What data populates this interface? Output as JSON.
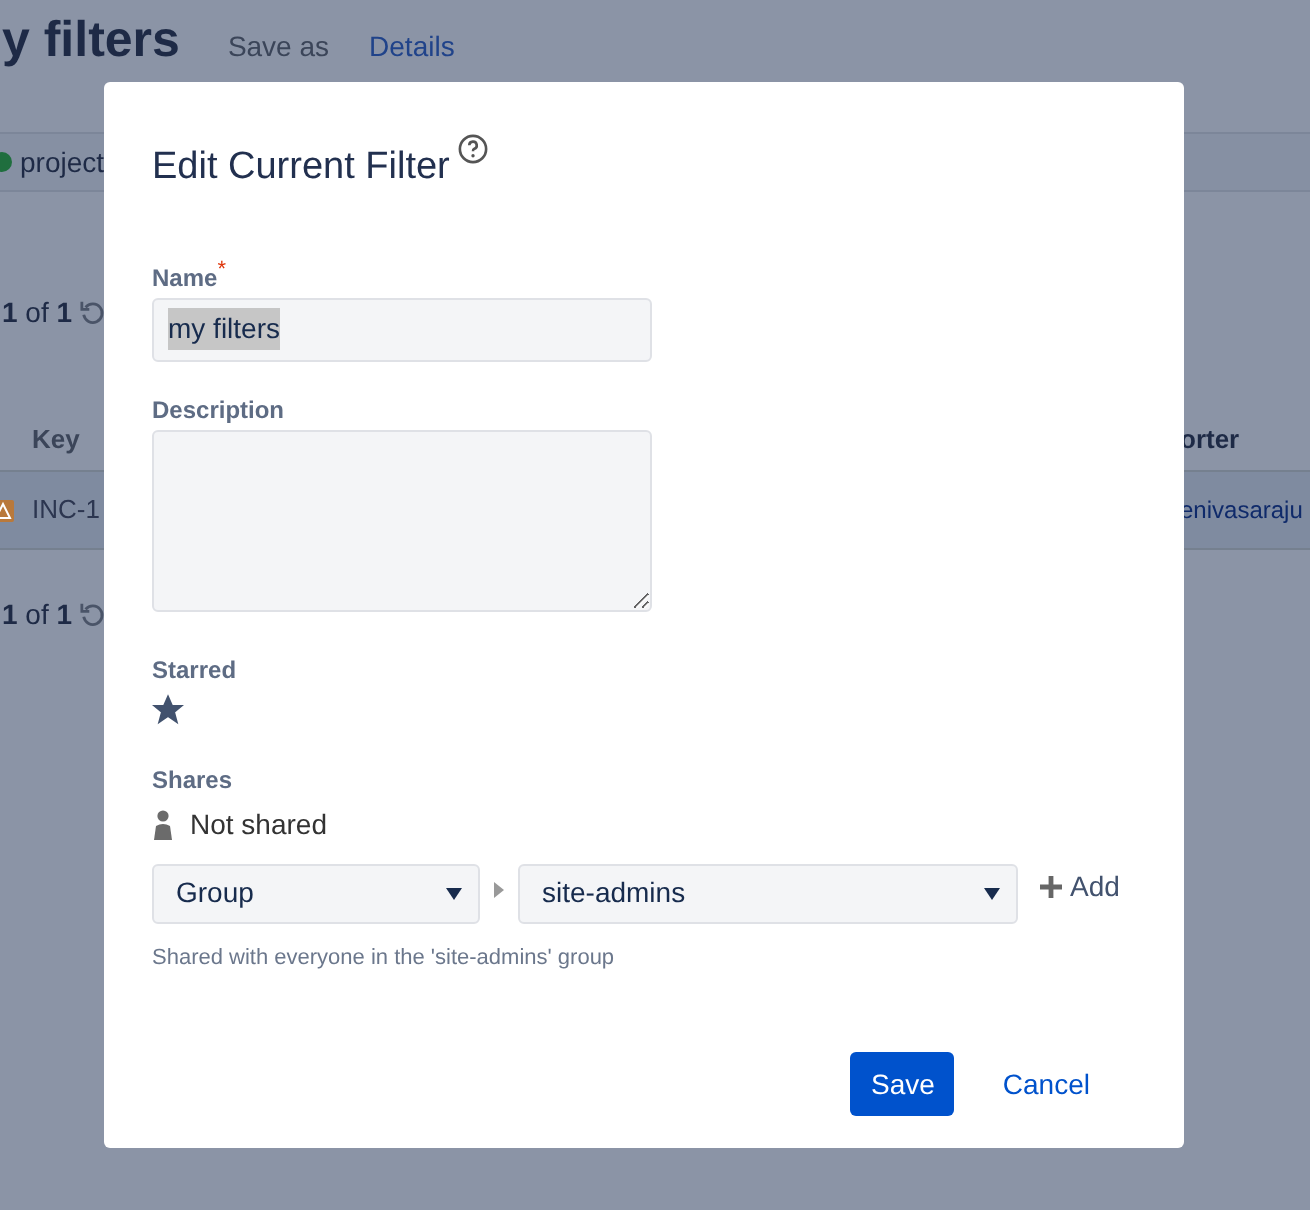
{
  "page": {
    "title": "y filters",
    "links": [
      {
        "label": "Save as",
        "kind": "plain"
      },
      {
        "label": "Details",
        "kind": "link"
      }
    ],
    "filter_chip": "project",
    "pager_top": {
      "current": "1",
      "of": "of",
      "total": "1"
    },
    "table": {
      "columns": [
        "Key",
        "orter"
      ],
      "rows": [
        {
          "key": "INC-1",
          "column_2": "enivasaraju"
        }
      ]
    },
    "pager_bottom": {
      "current": "1",
      "of": "of",
      "total": "1"
    }
  },
  "dialog": {
    "title": "Edit Current Filter",
    "name_field": {
      "label": "Name",
      "required_mark": "*",
      "value": "my filters"
    },
    "description_field": {
      "label": "Description"
    },
    "starred": {
      "label": "Starred",
      "on": true
    },
    "shares": {
      "label": "Shares",
      "status": "Not shared",
      "type_select": "Group",
      "group_select": "site-admins",
      "add": "Add",
      "hint": "Shared with everyone in the 'site-admins' group"
    },
    "buttons": [
      {
        "label": "Save",
        "kind": "primary"
      },
      {
        "label": "Cancel",
        "kind": "link"
      }
    ]
  }
}
